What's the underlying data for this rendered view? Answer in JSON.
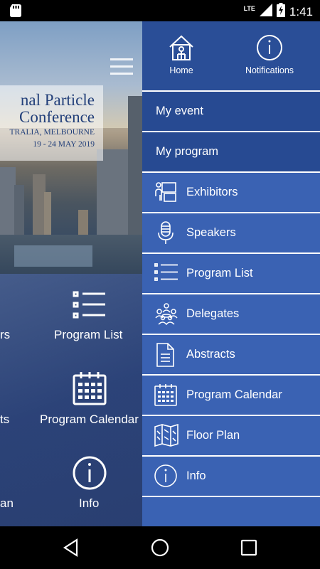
{
  "status_bar": {
    "time": "1:41",
    "network": "LTE",
    "icons": [
      "sd-card-icon",
      "signal-icon",
      "battery-charging-icon"
    ]
  },
  "background": {
    "banner": {
      "line1": "nal Particle",
      "line2": "Conference",
      "line3": "TRALIA, MELBOURNE",
      "line4": "19 - 24 MAY 2019"
    },
    "items": {
      "program_list": "Program List",
      "program_calendar": "Program Calendar",
      "info": "Info",
      "left_partial_1": "rs",
      "left_partial_2": "ts",
      "left_partial_3": "an"
    }
  },
  "drawer": {
    "top": {
      "home": "Home",
      "notifications": "Notifications"
    },
    "menu": [
      {
        "label": "My event",
        "icon": ""
      },
      {
        "label": "My program",
        "icon": ""
      },
      {
        "label": "Exhibitors",
        "icon": "exhibitor-booth-icon"
      },
      {
        "label": "Speakers",
        "icon": "microphone-icon"
      },
      {
        "label": "Program List",
        "icon": "list-icon"
      },
      {
        "label": "Delegates",
        "icon": "delegates-group-icon"
      },
      {
        "label": "Abstracts",
        "icon": "document-icon"
      },
      {
        "label": "Program Calendar",
        "icon": "calendar-icon"
      },
      {
        "label": "Floor Plan",
        "icon": "map-icon"
      },
      {
        "label": "Info",
        "icon": "info-icon"
      }
    ]
  },
  "nav_bar": {
    "buttons": [
      "back-icon",
      "home-circle-icon",
      "recents-square-icon"
    ]
  },
  "colors": {
    "drawer_bg": "#2f55a4",
    "drawer_dark": "#274a92",
    "drawer_light": "#3a62b3",
    "banner_text": "#23407a"
  }
}
